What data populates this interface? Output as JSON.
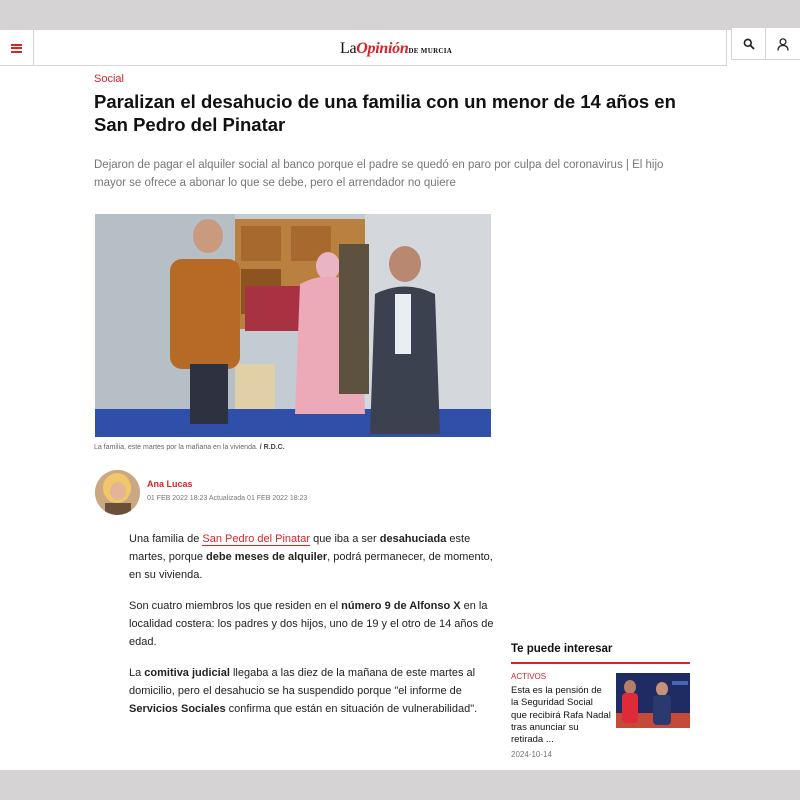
{
  "header": {
    "logo_prefix": "La",
    "logo_brand": "Opinión",
    "logo_suffix": "DE MURCIA"
  },
  "icons": {
    "menu": "hamburger-icon",
    "search": "search-icon",
    "user": "user-icon"
  },
  "colors": {
    "accent": "#d8232a"
  },
  "article": {
    "section": "Social",
    "title": "Paralizan el desahucio de una familia con un menor de 14 años en San Pedro del Pinatar",
    "subtitle": "Dejaron de pagar el alquiler social al banco porque el padre se quedó en paro por culpa del coronavirus | El hijo mayor se ofrece a abonar lo que se debe, pero el arrendador no quiere",
    "caption_text": "La familia, este martes por la mañana en la vivienda. ",
    "caption_credit": "/ R.D.C.",
    "author": "Ana Lucas",
    "published": "01 FEB 2022 18:23",
    "updated_label": "Actualizada",
    "updated": "01 FEB 2022 18:23",
    "p1": {
      "t1": "Una familia de ",
      "link": "San Pedro del Pinatar",
      "t2": " que iba a ser ",
      "b1": "desahuciada",
      "t3": " este martes, porque ",
      "b2": "debe meses de alquiler",
      "t4": ", podrá permanecer, de momento, en su vivienda."
    },
    "p2": {
      "t1": "Son cuatro miembros los que residen en el ",
      "b1": "número 9 de Alfonso X",
      "t2": " en la localidad costera: los padres y dos hijos, uno de 19 y el otro de 14 años de edad."
    },
    "p3": {
      "t1": "La ",
      "b1": "comitiva judicial",
      "t2": " llegaba a las diez de la mañana de este martes al domicilio, pero el desahucio se ha suspendido porque \"el informe de ",
      "b2": "Servicios Sociales",
      "t3": " confirma que están en situación de vulnerabilidad\"."
    }
  },
  "aside": {
    "title": "Te puede interesar",
    "tag": "ACTIVOS",
    "headline": "Esta es la pensión de la Seguridad Social que recibirá Rafa Nadal tras anunciar su retirada ...",
    "date": "2024-10-14"
  }
}
